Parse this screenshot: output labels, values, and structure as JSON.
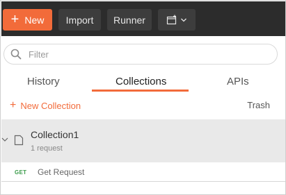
{
  "toolbar": {
    "new_label": "New",
    "import_label": "Import",
    "runner_label": "Runner",
    "new_window_icon": "new-window-icon",
    "accent_color": "#f26b3a",
    "bg_color": "#2c2c2c"
  },
  "search": {
    "placeholder": "Filter",
    "value": ""
  },
  "tabs": [
    {
      "label": "History",
      "active": false
    },
    {
      "label": "Collections",
      "active": true
    },
    {
      "label": "APIs",
      "active": false
    }
  ],
  "actions": {
    "new_collection_label": "New Collection",
    "trash_label": "Trash"
  },
  "collections": [
    {
      "name": "Collection1",
      "meta": "1 request",
      "requests": [
        {
          "method": "GET",
          "name": "Get Request"
        }
      ]
    }
  ]
}
